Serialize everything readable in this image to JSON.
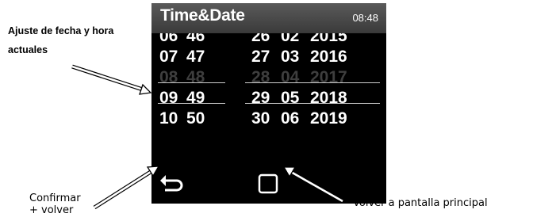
{
  "annotations": {
    "top_line1": "Ajuste de fecha y hora",
    "top_line2": "actuales",
    "bottom_left_line1": "Confirmar",
    "bottom_left_line2": "+ volver",
    "bottom_right": "Volver a pantalla principal"
  },
  "status_bar": {
    "title": "Time&Date",
    "clock": "08:48"
  },
  "picker": {
    "rows": [
      [
        "06",
        "46",
        "26",
        "02",
        "2015"
      ],
      [
        "07",
        "47",
        "27",
        "03",
        "2016"
      ],
      [
        "08",
        "48",
        "28",
        "04",
        "2017"
      ],
      [
        "09",
        "49",
        "29",
        "05",
        "2018"
      ],
      [
        "10",
        "50",
        "30",
        "06",
        "2019"
      ]
    ],
    "selected_row": 2
  },
  "navbar": {
    "back_icon": "back-arrow-icon",
    "home_icon": "square-home-icon"
  },
  "colors": {
    "screen_bg": "#000000",
    "text": "#ffffff",
    "selected_text": "#3e3e3e",
    "titlebar": "#4a4a4a"
  }
}
